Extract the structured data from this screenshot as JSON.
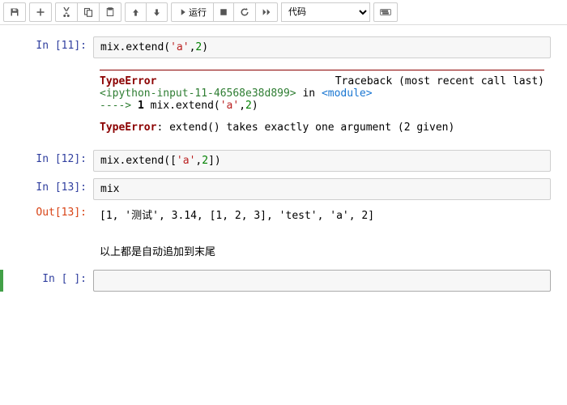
{
  "toolbar": {
    "run_label": "运行",
    "dropdown_selected": "代码"
  },
  "cells": {
    "c11": {
      "prompt": "In [11]:",
      "code_pre": "mix.extend(",
      "code_arg1": "'a'",
      "code_sep": ",",
      "code_arg2": "2",
      "code_post": ")",
      "err_hr": "",
      "err_name": "TypeError",
      "err_traceback": "Traceback (most recent call last)",
      "err_link": "<ipython-input-11-46568e38d899>",
      "err_in": " in ",
      "err_module": "<module>",
      "err_arrow": "----> ",
      "err_lineno": "1",
      "err_code_pre": " mix.extend(",
      "err_code_arg1": "'a'",
      "err_code_sep": ",",
      "err_code_arg2": "2",
      "err_code_post": ")",
      "err_name2": "TypeError",
      "err_msg": ": extend() takes exactly one argument (2 given)"
    },
    "c12": {
      "prompt": "In [12]:",
      "code_pre": "mix.extend([",
      "code_arg1": "'a'",
      "code_sep": ",",
      "code_arg2": "2",
      "code_post": "])"
    },
    "c13": {
      "prompt_in": "In [13]:",
      "code": "mix",
      "prompt_out": "Out[13]:",
      "output": "[1, '测试', 3.14, [1, 2, 3], 'test', 'a', 2]"
    },
    "md": {
      "text": "以上都是自动追加到末尾"
    },
    "empty": {
      "prompt": "In [ ]:"
    }
  }
}
